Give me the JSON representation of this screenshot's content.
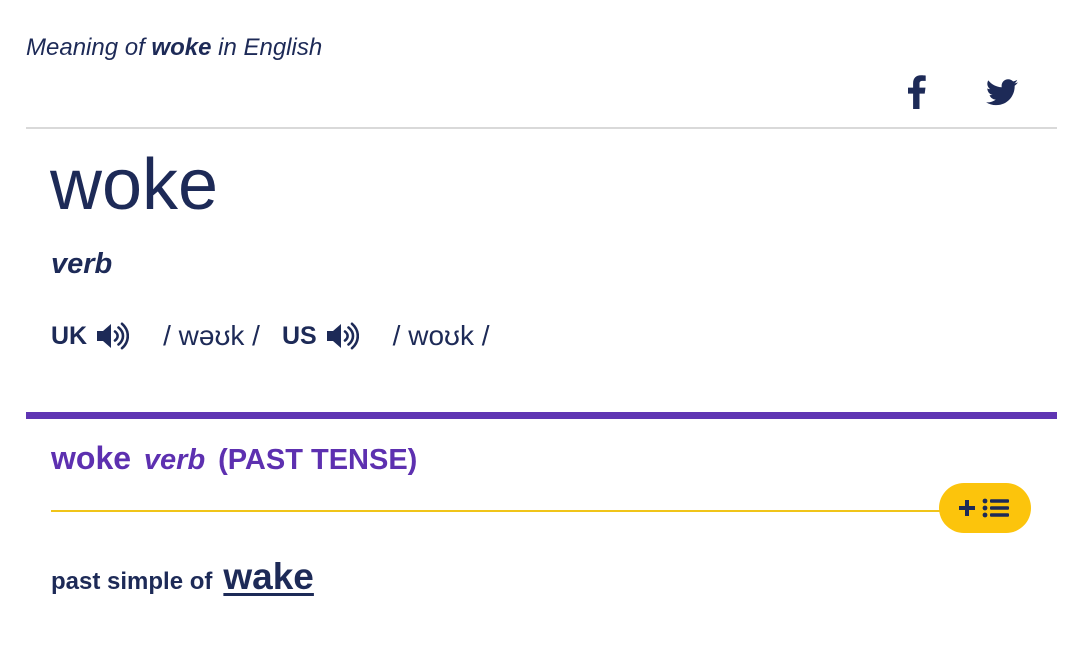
{
  "header": {
    "prefix": "Meaning of",
    "word": "woke",
    "suffix": "in English"
  },
  "social": {
    "facebook_icon": "facebook-icon",
    "twitter_icon": "twitter-icon"
  },
  "entry": {
    "headword": "woke",
    "part_of_speech": "verb",
    "pronunciations": [
      {
        "region": "UK",
        "ipa": "/ wəʊk /",
        "icon": "speaker-icon"
      },
      {
        "region": "US",
        "ipa": "/ woʊk /",
        "icon": "speaker-icon"
      }
    ]
  },
  "sense": {
    "word": "woke",
    "pos": "verb",
    "grammar": "(PAST TENSE)",
    "add_to_list_icon": "plus-list-icon",
    "definition_text": "past simple of",
    "definition_link": "wake"
  },
  "colors": {
    "navy": "#1d2a57",
    "purple": "#5f35b3",
    "yellow": "#fcc40c",
    "divider_gray": "#d9d9d9"
  }
}
